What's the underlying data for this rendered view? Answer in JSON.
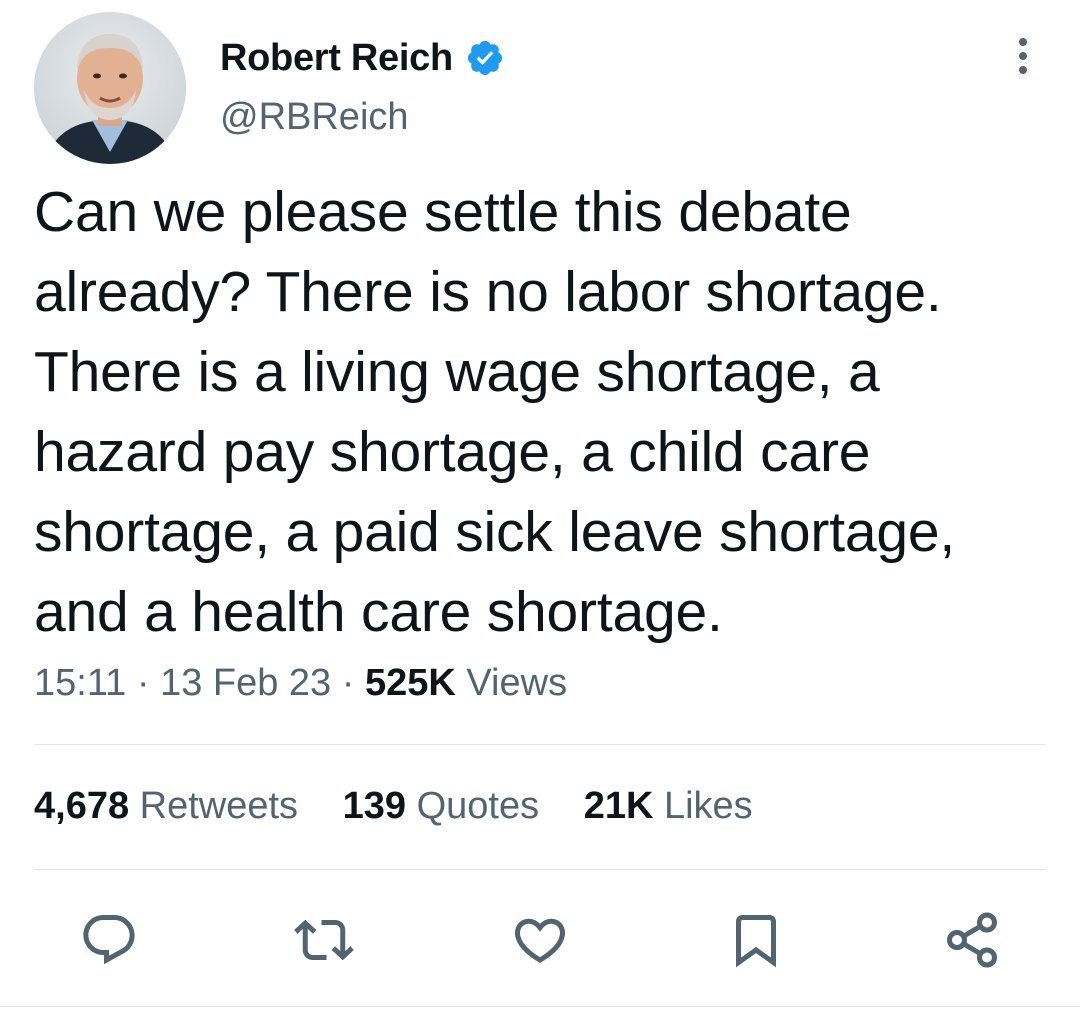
{
  "author": {
    "display_name": "Robert Reich",
    "handle": "@RBReich",
    "verified": true,
    "avatar_icon": "profile-photo"
  },
  "tweet": {
    "text": "Can we please settle this debate\nalready? There is no labor shortage.\nThere is a living wage shortage, a\nhazard pay shortage, a child care\nshortage, a paid sick leave shortage,\nand a health care shortage.",
    "time": "15:11",
    "separator": "·",
    "date": "13 Feb 23",
    "views_count": "525K",
    "views_label": "Views"
  },
  "stats": {
    "retweets_count": "4,678",
    "retweets_label": "Retweets",
    "quotes_count": "139",
    "quotes_label": "Quotes",
    "likes_count": "21K",
    "likes_label": "Likes"
  },
  "actions": [
    {
      "icon": "reply-icon"
    },
    {
      "icon": "retweet-icon"
    },
    {
      "icon": "like-icon"
    },
    {
      "icon": "bookmark-icon"
    },
    {
      "icon": "share-icon"
    }
  ],
  "colors": {
    "text_primary": "#0f1419",
    "text_secondary": "#536471",
    "verified_blue": "#1d9bf0",
    "divider": "#e1e6ea"
  }
}
